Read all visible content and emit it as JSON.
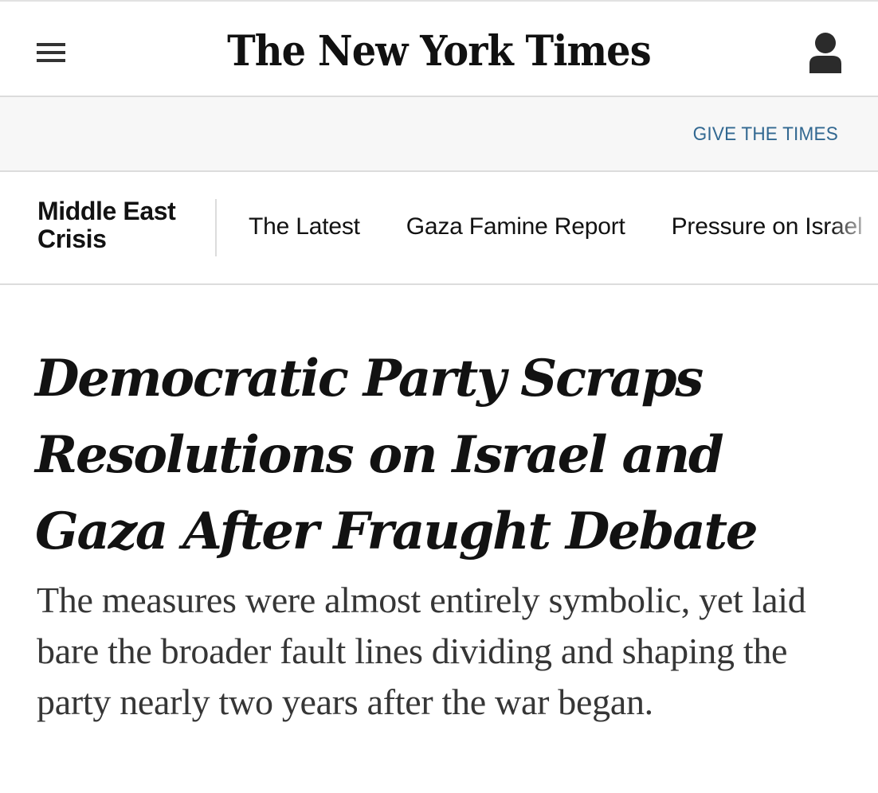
{
  "header": {
    "logo_text": "The New York Times",
    "menu_icon": "hamburger-menu-icon",
    "account_icon": "user-account-icon"
  },
  "promo": {
    "give_label": "GIVE THE TIMES"
  },
  "section_nav": {
    "section_title": "Middle East Crisis",
    "items": [
      {
        "label": "The Latest"
      },
      {
        "label": "Gaza Famine Report"
      },
      {
        "label": "Pressure on Israel"
      }
    ]
  },
  "article": {
    "headline": "Democratic Party Scraps Resolutions on Israel and Gaza After Fraught Debate",
    "summary": "The measures were almost entirely symbolic, yet laid bare the broader fault lines dividing and shaping the party nearly two years after the war began."
  },
  "colors": {
    "link_blue": "#326891",
    "text": "#121212",
    "summary_text": "#363636",
    "promo_bg": "#f7f7f7",
    "border": "#dcdcdc"
  }
}
